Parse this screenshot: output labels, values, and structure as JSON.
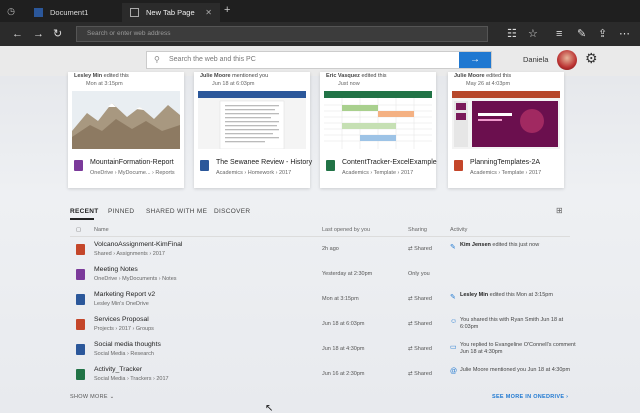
{
  "browser": {
    "tabs": [
      {
        "label": "Document1",
        "close": "✕"
      },
      {
        "label": "New Tab Page",
        "close": "✕"
      }
    ],
    "new_tab": "+",
    "address_placeholder": "Search or enter web address"
  },
  "header": {
    "search_placeholder": "Search the web and this PC",
    "search_go": "→",
    "user_name": "Daniela"
  },
  "cards": [
    {
      "who_name": "Lesley Min",
      "who_action": "edited this",
      "when": "Mon at 3:15pm",
      "name": "MountainFormation-Report",
      "path": "OneDrive › MyDocume... › Reports",
      "type": "one"
    },
    {
      "who_name": "Julie Moore",
      "who_action": "mentioned you",
      "when": "Jun 18 at 6:03pm",
      "name": "The Sewanee Review - History",
      "path": "Academics › Homework › 2017",
      "type": "word"
    },
    {
      "who_name": "Eric Vasquez",
      "who_action": "edited this",
      "when": "Just now",
      "name": "ContentTracker-ExcelExample",
      "path": "Academics › Template › 2017",
      "type": "xls"
    },
    {
      "who_name": "Julie Moore",
      "who_action": "edited this",
      "when": "May 26 at 4:03pm",
      "name": "PlanningTemplates-2A",
      "path": "Academics › Template › 2017",
      "type": "ppt"
    }
  ],
  "recent_tabs": {
    "recent": "RECENT",
    "pinned": "PINNED",
    "shared": "SHARED WITH ME",
    "discover": "DISCOVER"
  },
  "table": {
    "headers": {
      "name": "Name",
      "opened": "Last opened by you",
      "sharing": "Sharing",
      "activity": "Activity"
    },
    "rows": [
      {
        "name": "VolcanoAssignment-KimFinal",
        "path": "Shared › Assignments › 2017",
        "opened": "2h ago",
        "sharing": "Shared",
        "activity_bold": "Kim Jensen",
        "activity": " edited this just now",
        "type": "ppt"
      },
      {
        "name": "Meeting Notes",
        "path": "OneDrive › MyDocuments › Notes",
        "opened": "Yesterday at 2:30pm",
        "sharing": "Only you",
        "activity_bold": "",
        "activity": "",
        "type": "one"
      },
      {
        "name": "Marketing Report v2",
        "path": "Lesley Min's OneDrive",
        "opened": "Mon at 3:15pm",
        "sharing": "Shared",
        "activity_bold": "Lesley Min",
        "activity": " edited this Mon at 3:15pm",
        "type": "word"
      },
      {
        "name": "Services Proposal",
        "path": "Projects › 2017 › Groups",
        "opened": "Jun 18 at 6:03pm",
        "sharing": "Shared",
        "activity_bold": "",
        "activity": "You shared this with Ryan Smith Jun 18 at 6:03pm",
        "type": "ppt"
      },
      {
        "name": "Social media thoughts",
        "path": "Social Media › Research",
        "opened": "Jun 18 at 4:30pm",
        "sharing": "Shared",
        "activity_bold": "",
        "activity": "You replied to Evangeline O'Connell's comment Jun 18 at 4:30pm",
        "type": "word"
      },
      {
        "name": "Activity_Tracker",
        "path": "Social Media › Trackers › 2017",
        "opened": "Jun 16 at 2:30pm",
        "sharing": "Shared",
        "activity_bold": "",
        "activity": "Julie Moore mentioned you Jun 18 at 4:30pm",
        "type": "xls"
      }
    ]
  },
  "footer": {
    "show_more": "SHOW MORE ⌄",
    "see_more": "SEE MORE IN ONEDRIVE ›"
  }
}
